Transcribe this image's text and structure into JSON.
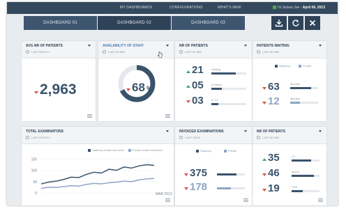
{
  "nav": {
    "links": [
      "MY DASHBOARDS",
      "CONFIGURATIONS",
      "WHAT'S NEW"
    ],
    "user_greeting": "Hi Jackes Joe -",
    "date": "April 04, 2013"
  },
  "tabs": [
    "DASHBOARD 01",
    "DASHBOARD 02",
    "DASHBOARD 03"
  ],
  "actions": {
    "download_icon": "download-icon",
    "refresh_icon": "refresh-icon",
    "close_icon": "close-icon"
  },
  "cards": {
    "avg_patients": {
      "title": "AVG NR OF PATIENTS",
      "period": "LAST MONTH",
      "value": "2,963",
      "trend": "down"
    },
    "staff": {
      "title": "AVAILABILITY OF STAFF",
      "period": "LAST 60 MIN",
      "value": "68",
      "unit": "%",
      "trend": "down",
      "gauge_fraction": 0.68
    },
    "nr_patients": {
      "title": "NR OF PATIENTS",
      "period": "LAST 60 MIN",
      "rows": [
        {
          "value": "21",
          "label": "Waiting",
          "trend": "up",
          "fill": 0.7
        },
        {
          "value": "05",
          "label": "In Mamo",
          "trend": "up",
          "fill": 0.3
        },
        {
          "value": "03",
          "label": "In CT",
          "trend": "down",
          "fill": 0.2
        }
      ]
    },
    "waiting": {
      "title": "PATIENTS WAITING",
      "period": "LAST 60 MIN",
      "legend": [
        "Statutory",
        "Private"
      ],
      "rows": [
        {
          "value": "63",
          "label": "Minutes",
          "trend": "down",
          "fill": 0.75,
          "series": "statutory"
        },
        {
          "value": "12",
          "label": "Minutes",
          "trend": "down",
          "fill": 0.35,
          "series": "private"
        }
      ]
    },
    "exams": {
      "title": "TOTAL EXAMINATONS",
      "period": "LAST MONTH",
      "legend": [
        "Statutory health insurance",
        "Private health insurance"
      ]
    },
    "invoiced": {
      "title": "INVOICED EXAMINATIONS",
      "period": "LAST YEAR",
      "legend": [
        "Statutory",
        "Private"
      ],
      "rows": [
        {
          "value": "375",
          "trend": "down",
          "fill": 0.7,
          "series": "statutory"
        },
        {
          "value": "178",
          "trend": "down",
          "fill": 0.5,
          "series": "private"
        }
      ]
    },
    "nr_patients2": {
      "title": "NR OF PATIENTS",
      "period": "LAST 60 MIN",
      "rows": [
        {
          "value": "35",
          "label": "CT",
          "trend": "up",
          "fill": 0.7
        },
        {
          "value": "46",
          "label": "Mamo",
          "trend": "down",
          "fill": 0.8
        },
        {
          "value": "19",
          "label": "CPD",
          "trend": "down",
          "fill": 0.4
        }
      ]
    }
  },
  "colors": {
    "statutory": "#3a536c",
    "private": "#8fa3c5",
    "up": "#3fa66b",
    "down": "#d9534f",
    "topbar": "#34495e"
  },
  "chart_data": {
    "type": "line",
    "x": [
      1,
      2,
      3,
      4,
      5,
      6,
      7,
      8,
      9,
      10,
      11,
      12,
      13,
      14,
      15,
      16
    ],
    "x_tick_label": "MAR 2013",
    "yticks": [
      0,
      50,
      100,
      150
    ],
    "ylim": [
      0,
      170
    ],
    "series": [
      {
        "name": "Statutory health insurance",
        "values": [
          40,
          48,
          52,
          60,
          70,
          68,
          82,
          92,
          88,
          105,
          100,
          115,
          110,
          120,
          125,
          122
        ]
      },
      {
        "name": "Private health insurance",
        "values": [
          20,
          25,
          24,
          28,
          32,
          30,
          38,
          42,
          40,
          45,
          48,
          52,
          50,
          58,
          62,
          64
        ]
      }
    ],
    "legend": "top"
  }
}
